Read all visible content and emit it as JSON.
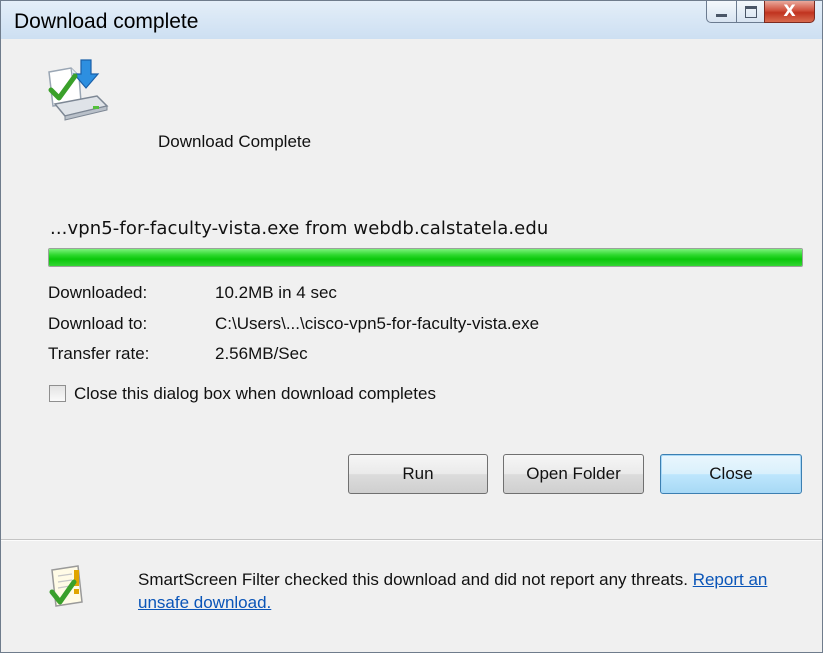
{
  "window": {
    "title": "Download complete",
    "controls": {
      "minimize": "minimize",
      "maximize": "maximize",
      "close": "X"
    }
  },
  "status": {
    "heading": "Download Complete",
    "source": "...vpn5-for-faculty-vista.exe from webdb.calstatela.edu"
  },
  "progress": {
    "percent": 100,
    "color": "#11c711"
  },
  "info": {
    "downloaded_label": "Downloaded:",
    "downloaded_value": "10.2MB in 4 sec",
    "download_to_label": "Download to:",
    "download_to_value": "C:\\Users\\...\\cisco-vpn5-for-faculty-vista.exe",
    "rate_label": "Transfer rate:",
    "rate_value": "2.56MB/Sec"
  },
  "options": {
    "close_on_complete_label": "Close this dialog box when download completes",
    "close_on_complete_checked": false
  },
  "buttons": {
    "run": "Run",
    "open_folder": "Open Folder",
    "close": "Close"
  },
  "smartscreen": {
    "text": "SmartScreen Filter checked this download and did not report any threats.",
    "link": "Report an unsafe download."
  },
  "icons": {
    "download_icon": "download-complete-icon",
    "smartscreen_icon": "smartscreen-checked-icon"
  },
  "colors": {
    "link": "#0a55b8",
    "accent": "#3c7fb1"
  }
}
